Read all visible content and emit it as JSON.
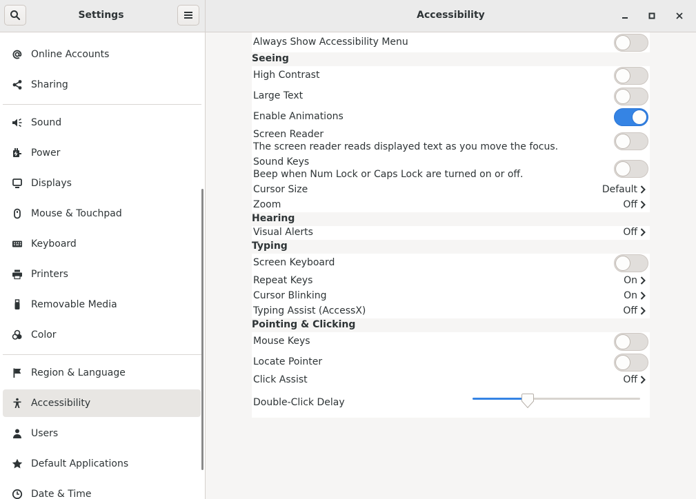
{
  "sidebar": {
    "title": "Settings",
    "items": [
      {
        "label": "Online Accounts",
        "icon": "at-icon"
      },
      {
        "label": "Sharing",
        "icon": "share-icon"
      },
      {
        "label": "Sound",
        "icon": "speaker-icon"
      },
      {
        "label": "Power",
        "icon": "power-icon"
      },
      {
        "label": "Displays",
        "icon": "monitor-icon"
      },
      {
        "label": "Mouse & Touchpad",
        "icon": "mouse-icon"
      },
      {
        "label": "Keyboard",
        "icon": "keyboard-icon"
      },
      {
        "label": "Printers",
        "icon": "printer-icon"
      },
      {
        "label": "Removable Media",
        "icon": "usb-icon"
      },
      {
        "label": "Color",
        "icon": "color-icon"
      },
      {
        "label": "Region & Language",
        "icon": "flag-icon"
      },
      {
        "label": "Accessibility",
        "icon": "accessibility-icon",
        "active": true
      },
      {
        "label": "Users",
        "icon": "users-icon"
      },
      {
        "label": "Default Applications",
        "icon": "star-icon"
      },
      {
        "label": "Date & Time",
        "icon": "clock-icon"
      }
    ]
  },
  "header": {
    "title": "Accessibility"
  },
  "accessibility": {
    "always_show_menu": {
      "label": "Always Show Accessibility Menu",
      "on": false
    },
    "seeing": {
      "title": "Seeing",
      "high_contrast": {
        "label": "High Contrast",
        "on": false
      },
      "large_text": {
        "label": "Large Text",
        "on": false
      },
      "enable_animations": {
        "label": "Enable Animations",
        "on": true
      },
      "screen_reader": {
        "label": "Screen Reader",
        "description": "The screen reader reads displayed text as you move the focus.",
        "on": false
      },
      "sound_keys": {
        "label": "Sound Keys",
        "description": "Beep when Num Lock or Caps Lock are turned on or off.",
        "on": false
      },
      "cursor_size": {
        "label": "Cursor Size",
        "value": "Default"
      },
      "zoom": {
        "label": "Zoom",
        "value": "Off"
      }
    },
    "hearing": {
      "title": "Hearing",
      "visual_alerts": {
        "label": "Visual Alerts",
        "value": "Off"
      }
    },
    "typing": {
      "title": "Typing",
      "screen_keyboard": {
        "label": "Screen Keyboard",
        "on": false
      },
      "repeat_keys": {
        "label": "Repeat Keys",
        "value": "On"
      },
      "cursor_blinking": {
        "label": "Cursor Blinking",
        "value": "On"
      },
      "typing_assist": {
        "label": "Typing Assist (AccessX)",
        "value": "Off"
      }
    },
    "pointing": {
      "title": "Pointing & Clicking",
      "mouse_keys": {
        "label": "Mouse Keys",
        "on": false
      },
      "locate_pointer": {
        "label": "Locate Pointer",
        "on": false
      },
      "click_assist": {
        "label": "Click Assist",
        "value": "Off"
      },
      "double_click_delay": {
        "label": "Double-Click Delay",
        "level": 0.33
      }
    }
  },
  "colors": {
    "accent": "#3584e4",
    "headerbar": "#ebebeb",
    "window_bg": "#f6f5f4"
  }
}
